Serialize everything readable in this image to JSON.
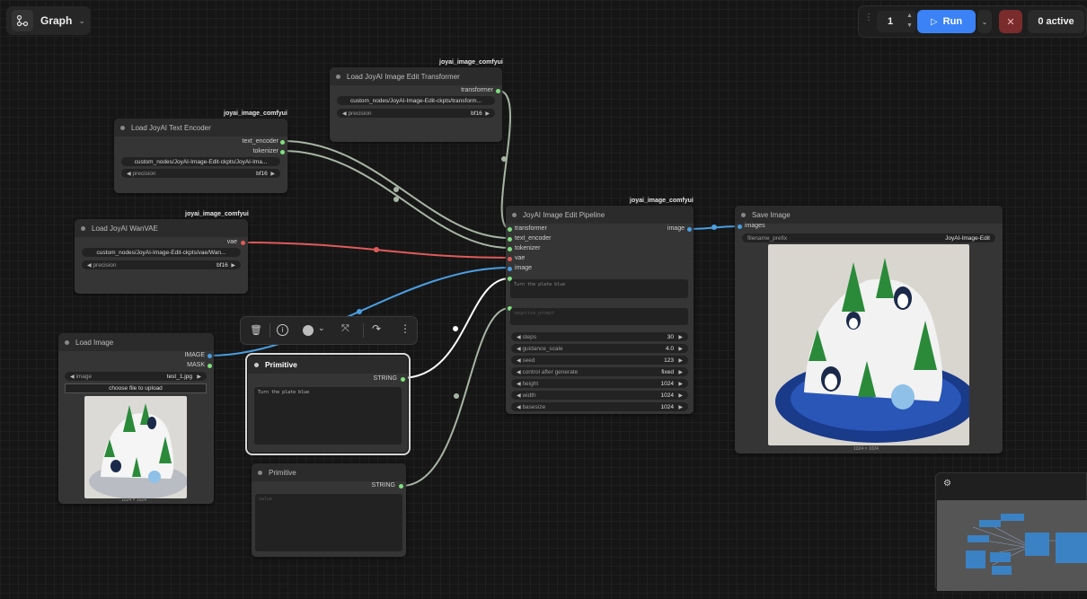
{
  "graph_button": {
    "label": "Graph"
  },
  "run_controls": {
    "count": "1",
    "run_label": "Run",
    "active_label": "0 active"
  },
  "nodes": {
    "transformer": {
      "tag": "joyai_image_comfyui",
      "title": "Load JoyAI Image Edit Transformer",
      "output": "transformer",
      "path": "custom_nodes/JoyAI-Image-Edit-ckpts/transform...",
      "precision_label": "precision",
      "precision_value": "bf16"
    },
    "text_encoder": {
      "tag": "joyai_image_comfyui",
      "title": "Load JoyAI Text Encoder",
      "out1": "text_encoder",
      "out2": "tokenizer",
      "path": "custom_nodes/JoyAI-Image-Edit-ckpts/JoyAI-Ima...",
      "precision_label": "precision",
      "precision_value": "bf16"
    },
    "vae": {
      "tag": "joyai_image_comfyui",
      "title": "Load JoyAI WanVAE",
      "output": "vae",
      "path": "custom_nodes/JoyAI-Image-Edit-ckpts/vae/Wan...",
      "precision_label": "precision",
      "precision_value": "bf16"
    },
    "pipeline": {
      "tag": "joyai_image_comfyui",
      "title": "JoyAI Image Edit Pipeline",
      "inputs": [
        "transformer",
        "text_encoder",
        "tokenizer",
        "vae",
        "image"
      ],
      "output": "image",
      "prompt": "Turn the plate blue",
      "negative": "negative_prompt",
      "params": [
        {
          "label": "steps",
          "value": "30"
        },
        {
          "label": "guidance_scale",
          "value": "4.0"
        },
        {
          "label": "seed",
          "value": "123"
        },
        {
          "label": "control after generate",
          "value": "fixed"
        },
        {
          "label": "height",
          "value": "1024"
        },
        {
          "label": "width",
          "value": "1024"
        },
        {
          "label": "basesize",
          "value": "1024"
        }
      ]
    },
    "save": {
      "title": "Save Image",
      "input": "images",
      "prefix_label": "filename_prefix",
      "prefix_value": "JoyAI-Image-Edit",
      "caption": "1024 × 1024"
    },
    "load_image": {
      "title": "Load Image",
      "out1": "IMAGE",
      "out2": "MASK",
      "image_label": "image",
      "image_value": "test_1.jpg",
      "upload": "choose file to upload",
      "caption": "1024 × 1024"
    },
    "primitive1": {
      "title": "Primitive",
      "output": "STRING",
      "text": "Turn the plate blue"
    },
    "primitive2": {
      "title": "Primitive",
      "output": "STRING",
      "text": "value"
    }
  },
  "colors": {
    "canvas": "#161616",
    "node": "#353535",
    "run": "#3b82f6",
    "vae_wire": "#e05a5a",
    "image_wire": "#4a9ee0",
    "model_wire": "#a6b5a3"
  }
}
